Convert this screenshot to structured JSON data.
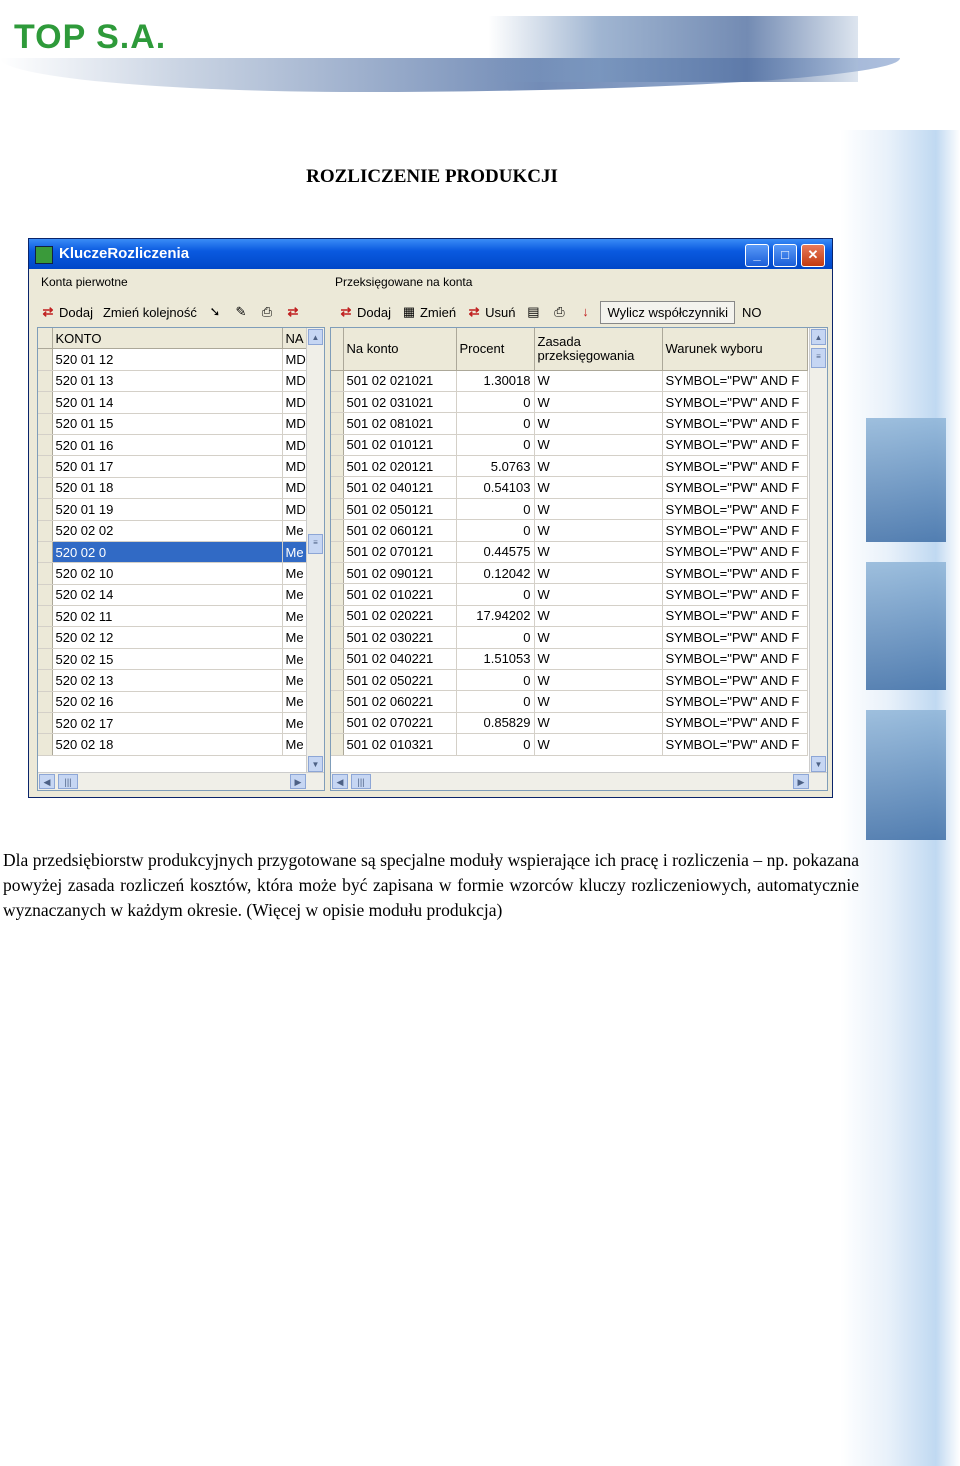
{
  "header": {
    "logo_text": "TOP S.A."
  },
  "title": "ROZLICZENIE PRODUKCJI",
  "window": {
    "title": "KluczeRozliczenia",
    "left_panel": {
      "group_label": "Konta pierwotne",
      "toolbar": {
        "add": "Dodaj",
        "reorder": "Zmień kolejność"
      },
      "columns": [
        "KONTO",
        "NA"
      ],
      "rows": [
        [
          "520 01 12",
          "MD"
        ],
        [
          "520 01 13",
          "MD"
        ],
        [
          "520 01 14",
          "MD"
        ],
        [
          "520 01 15",
          "MD"
        ],
        [
          "520 01 16",
          "MD"
        ],
        [
          "520 01 17",
          "MD"
        ],
        [
          "520 01 18",
          "MD"
        ],
        [
          "520 01 19",
          "MD"
        ],
        [
          "520 02 02",
          "Me"
        ],
        [
          "520 02 0",
          "Me"
        ],
        [
          "520 02 10",
          "Me"
        ],
        [
          "520 02 14",
          "Me"
        ],
        [
          "520 02 11",
          "Me"
        ],
        [
          "520 02 12",
          "Me"
        ],
        [
          "520 02 15",
          "Me"
        ],
        [
          "520 02 13",
          "Me"
        ],
        [
          "520 02 16",
          "Me"
        ],
        [
          "520 02 17",
          "Me"
        ],
        [
          "520 02 18",
          "Me"
        ]
      ],
      "selected_index": 9
    },
    "right_panel": {
      "group_label": "Przeksięgowane na konta",
      "toolbar": {
        "add": "Dodaj",
        "edit": "Zmień",
        "delete": "Usuń",
        "calc": "Wylicz współczynniki",
        "extra": "NO"
      },
      "columns": [
        "Na konto",
        "Procent",
        "Zasada\nprzeksięgowania",
        "Warunek wyboru"
      ],
      "rows": [
        [
          "501 02 021021",
          "1.30018",
          "W",
          "SYMBOL=\"PW\" AND F"
        ],
        [
          "501 02 031021",
          "0",
          "W",
          "SYMBOL=\"PW\" AND F"
        ],
        [
          "501 02 081021",
          "0",
          "W",
          "SYMBOL=\"PW\" AND F"
        ],
        [
          "501 02 010121",
          "0",
          "W",
          "SYMBOL=\"PW\" AND F"
        ],
        [
          "501 02 020121",
          "5.0763",
          "W",
          "SYMBOL=\"PW\" AND F"
        ],
        [
          "501 02 040121",
          "0.54103",
          "W",
          "SYMBOL=\"PW\" AND F"
        ],
        [
          "501 02 050121",
          "0",
          "W",
          "SYMBOL=\"PW\" AND F"
        ],
        [
          "501 02 060121",
          "0",
          "W",
          "SYMBOL=\"PW\" AND F"
        ],
        [
          "501 02 070121",
          "0.44575",
          "W",
          "SYMBOL=\"PW\" AND F"
        ],
        [
          "501 02 090121",
          "0.12042",
          "W",
          "SYMBOL=\"PW\" AND F"
        ],
        [
          "501 02 010221",
          "0",
          "W",
          "SYMBOL=\"PW\" AND F"
        ],
        [
          "501 02 020221",
          "17.94202",
          "W",
          "SYMBOL=\"PW\" AND F"
        ],
        [
          "501 02 030221",
          "0",
          "W",
          "SYMBOL=\"PW\" AND F"
        ],
        [
          "501 02 040221",
          "1.51053",
          "W",
          "SYMBOL=\"PW\" AND F"
        ],
        [
          "501 02 050221",
          "0",
          "W",
          "SYMBOL=\"PW\" AND F"
        ],
        [
          "501 02 060221",
          "0",
          "W",
          "SYMBOL=\"PW\" AND F"
        ],
        [
          "501 02 070221",
          "0.85829",
          "W",
          "SYMBOL=\"PW\" AND F"
        ],
        [
          "501 02 010321",
          "0",
          "W",
          "SYMBOL=\"PW\" AND F"
        ]
      ]
    }
  },
  "body_text": "Dla przedsiębiorstw produkcyjnych przygotowane są specjalne moduły wspierające ich pracę i rozliczenia – np. pokazana powyżej zasada rozliczeń kosztów, która może być zapisana w formie wzorców kluczy rozliczeniowych, automatycznie wyznaczanych w każdym okresie. (Więcej w opisie modułu produkcja)"
}
